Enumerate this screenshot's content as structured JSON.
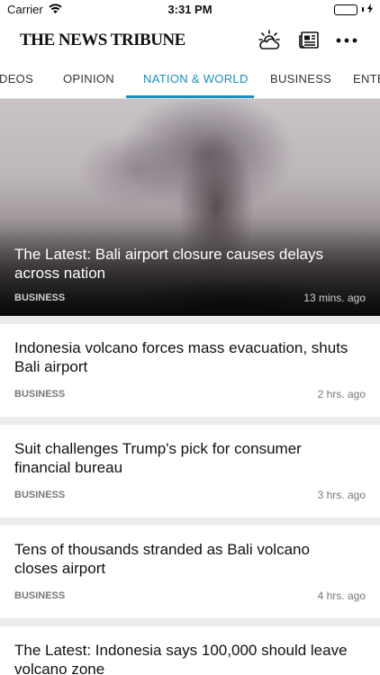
{
  "status_bar": {
    "carrier": "Carrier",
    "time": "3:31 PM",
    "battery_level": 1.0,
    "charging_icon": "bolt-icon"
  },
  "header": {
    "brand": "THE NEWS TRIBUNE",
    "icons": [
      "weather-icon",
      "newspaper-icon",
      "more-icon"
    ]
  },
  "tabs": {
    "items": [
      {
        "label": "DEOS"
      },
      {
        "label": "OPINION"
      },
      {
        "label": "NATION & WORLD"
      },
      {
        "label": "BUSINESS"
      },
      {
        "label": "ENTE"
      }
    ],
    "active_index": 2,
    "accent_color": "#1a8fbd"
  },
  "hero": {
    "title": "The Latest: Bali airport closure causes delays across nation",
    "category": "BUSINESS",
    "time": "13 mins. ago"
  },
  "articles": [
    {
      "title": "Indonesia volcano forces mass evacuation, shuts Bali airport",
      "category": "BUSINESS",
      "time": "2 hrs. ago"
    },
    {
      "title": "Suit challenges Trump's pick for consumer financial bureau",
      "category": "BUSINESS",
      "time": "3 hrs. ago"
    },
    {
      "title": "Tens of thousands stranded as Bali volcano closes airport",
      "category": "BUSINESS",
      "time": "4 hrs. ago"
    },
    {
      "title": "The Latest: Indonesia says 100,000 should leave volcano zone",
      "category": "",
      "time": ""
    }
  ]
}
